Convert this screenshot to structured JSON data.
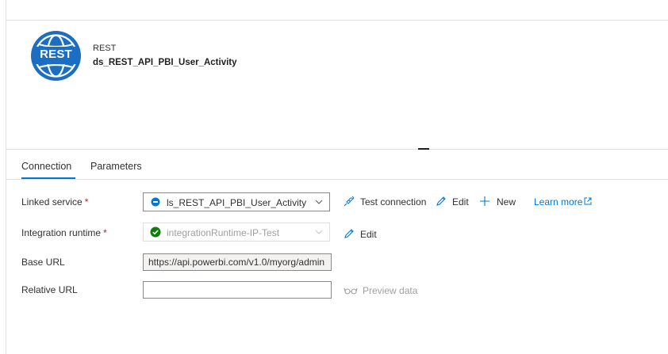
{
  "header": {
    "logo_text": "REST",
    "type_label": "REST",
    "dataset_name": "ds_REST_API_PBI_User_Activity"
  },
  "tabs": [
    {
      "label": "Connection",
      "active": true
    },
    {
      "label": "Parameters",
      "active": false
    }
  ],
  "form": {
    "linked_service": {
      "label": "Linked service",
      "required_mark": "*",
      "value": "ls_REST_API_PBI_User_Activity",
      "actions": {
        "test_connection": "Test connection",
        "edit": "Edit",
        "new": "New",
        "learn_more": "Learn more"
      }
    },
    "integration_runtime": {
      "label": "Integration runtime",
      "required_mark": "*",
      "value": "integrationRuntime-IP-Test",
      "edit": "Edit"
    },
    "base_url": {
      "label": "Base URL",
      "value": "https://api.powerbi.com/v1.0/myorg/admin"
    },
    "relative_url": {
      "label": "Relative URL",
      "value": "",
      "preview": "Preview data"
    }
  },
  "colors": {
    "accent": "#0078d4",
    "logo_bg": "#1b6ec2",
    "success": "#107c10",
    "required": "#a4262c"
  },
  "icons": [
    "globe-icon",
    "linked-service-icon",
    "chevron-down-icon",
    "check-circle-icon",
    "plug-icon",
    "pencil-icon",
    "plus-icon",
    "external-link-icon",
    "glasses-icon"
  ]
}
